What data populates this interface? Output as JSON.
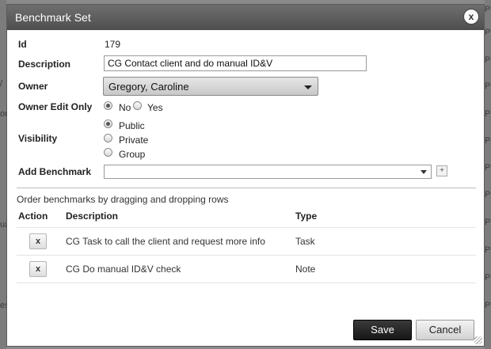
{
  "background": {
    "left_fragments": [
      "/",
      "or",
      "ua",
      "es"
    ],
    "right_fragments": [
      "Pub",
      "Pub",
      "Pub",
      "Pub",
      "Pub",
      "Pub",
      "Pub",
      "Pub",
      "Pub",
      "Pub",
      "Pub",
      "Pub"
    ]
  },
  "dialog": {
    "title": "Benchmark Set",
    "close_label": "x"
  },
  "form": {
    "id_label": "Id",
    "id_value": "179",
    "description_label": "Description",
    "description_value": "CG Contact client and do manual ID&V",
    "owner_label": "Owner",
    "owner_value": "Gregory, Caroline",
    "owner_edit_label": "Owner Edit Only",
    "owner_edit_options": [
      "No",
      "Yes"
    ],
    "owner_edit_selected": "No",
    "visibility_label": "Visibility",
    "visibility_options": [
      "Public",
      "Private",
      "Group"
    ],
    "visibility_selected": "Public",
    "add_benchmark_label": "Add Benchmark",
    "add_benchmark_value": "",
    "add_button_label": "+"
  },
  "benchmarks": {
    "hint": "Order benchmarks by dragging and dropping rows",
    "columns": [
      "Action",
      "Description",
      "Type"
    ],
    "remove_label": "x",
    "rows": [
      {
        "description": "CG Task to call the client and request more info",
        "type": "Task"
      },
      {
        "description": "CG Do manual ID&V check",
        "type": "Note"
      }
    ]
  },
  "buttons": {
    "save": "Save",
    "cancel": "Cancel"
  }
}
